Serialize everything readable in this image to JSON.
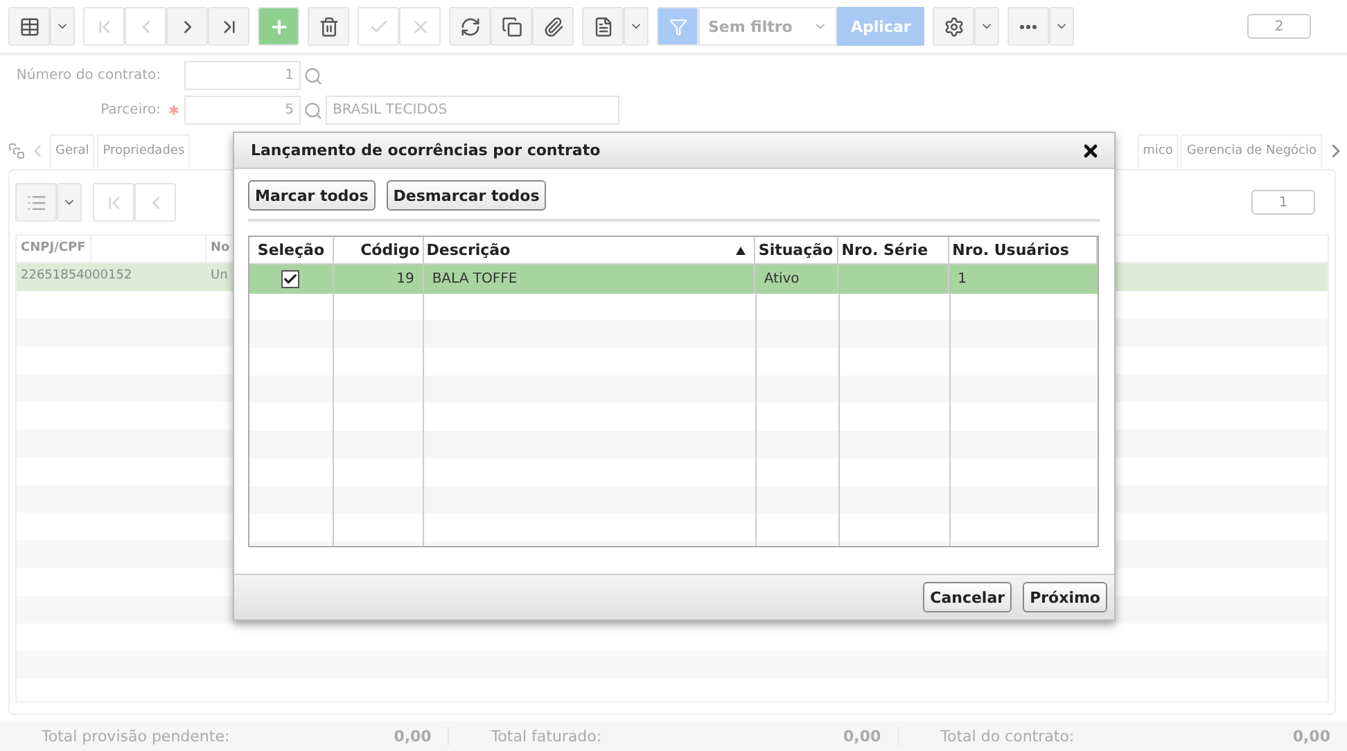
{
  "toolbar": {
    "buttons": [
      {
        "kind": "table",
        "disabled": false
      },
      {
        "kind": "first",
        "disabled": true
      },
      {
        "kind": "previous",
        "disabled": true
      },
      {
        "kind": "next",
        "disabled": false
      },
      {
        "kind": "last",
        "disabled": false
      },
      {
        "kind": "add",
        "disabled": false
      },
      {
        "kind": "delete",
        "disabled": false
      },
      {
        "kind": "confirm",
        "disabled": true
      },
      {
        "kind": "cancel",
        "disabled": true
      },
      {
        "kind": "refresh",
        "disabled": false
      },
      {
        "kind": "copy",
        "disabled": false
      },
      {
        "kind": "attach",
        "disabled": false
      },
      {
        "kind": "report",
        "disabled": false
      }
    ],
    "filter": {
      "value": "Sem filtro"
    },
    "apply": "Aplicar",
    "record_count": "2"
  },
  "form": {
    "fields": [
      {
        "label": "Número do contrato:",
        "value": "1",
        "required": false
      },
      {
        "label": "Parceiro:",
        "value": "5",
        "required": true,
        "description": "BRASIL TECIDOS"
      }
    ]
  },
  "tabs": [
    {
      "label": "Geral"
    },
    {
      "label": "Propriedades"
    },
    {
      "label": "mico"
    },
    {
      "label": "Gerencia de Negócio"
    }
  ],
  "grid": {
    "record_count": "1",
    "columns": [
      "CNPJ/CPF",
      "No"
    ],
    "rows": [
      {
        "cells": [
          "22651854000152",
          "Un"
        ],
        "selected": true
      }
    ]
  },
  "totals": [
    {
      "label": "Total provisão pendente:",
      "value": "0,00"
    },
    {
      "label": "Total faturado:",
      "value": "0,00"
    },
    {
      "label": "Total do contrato:",
      "value": "0,00"
    }
  ],
  "dialog": {
    "title": "Lançamento de ocorrências por contrato",
    "actions": [
      "Marcar todos",
      "Desmarcar todos"
    ],
    "columns": [
      {
        "label": "Seleção"
      },
      {
        "label": "Código"
      },
      {
        "label": "Descrição",
        "sorted": true
      },
      {
        "label": "Situação"
      },
      {
        "label": "Nro. Série"
      },
      {
        "label": "Nro. Usuários"
      }
    ],
    "rows": [
      {
        "checked": true,
        "selected": true,
        "codigo": "19",
        "descricao": "BALA TOFFE",
        "situacao": "Ativo",
        "nro_usuarios": "1"
      }
    ],
    "buttons": [
      "Cancelar",
      "Próximo"
    ]
  }
}
